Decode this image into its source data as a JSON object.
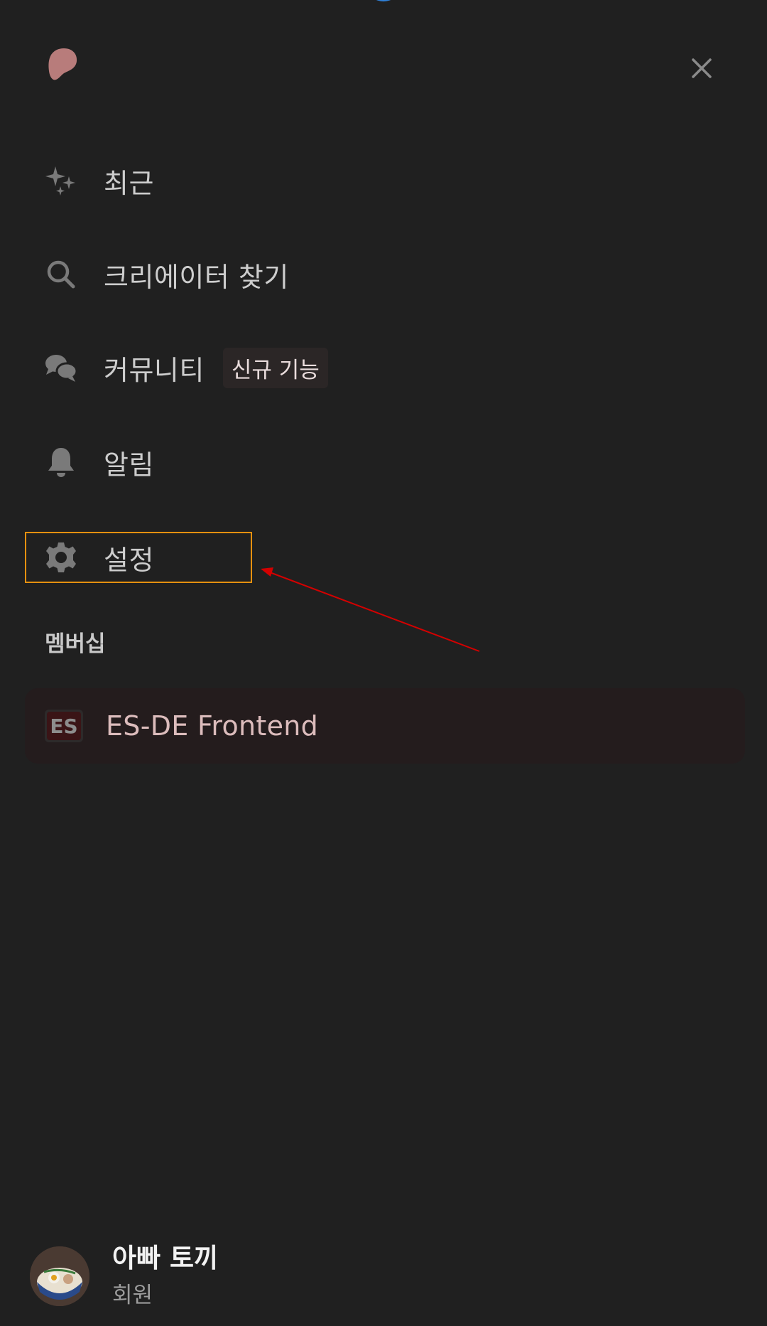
{
  "icons": {
    "logo": "patreon-logo-icon",
    "close": "close-icon",
    "recent": "sparkles-icon",
    "search": "search-icon",
    "community": "chat-bubbles-icon",
    "notifications": "bell-icon",
    "settings": "gear-icon",
    "membership": "es-de-logo-icon"
  },
  "colors": {
    "background": "#202020",
    "logo": "#b87c7b",
    "highlight_box": "#e5900f",
    "annotation_arrow": "#d40000",
    "membership_card": "#241c1d",
    "membership_text": "#dcbcbc"
  },
  "nav": {
    "recent_label": "최근",
    "search_label": "크리에이터 찾기",
    "community_label": "커뮤니티",
    "community_badge": "신규 기능",
    "notifications_label": "알림",
    "settings_label": "설정"
  },
  "membership": {
    "section_title": "멤버십",
    "items": [
      {
        "name": "ES-DE Frontend",
        "logo_text": "ES"
      }
    ]
  },
  "profile": {
    "name": "아빠 토끼",
    "role": "회원"
  }
}
